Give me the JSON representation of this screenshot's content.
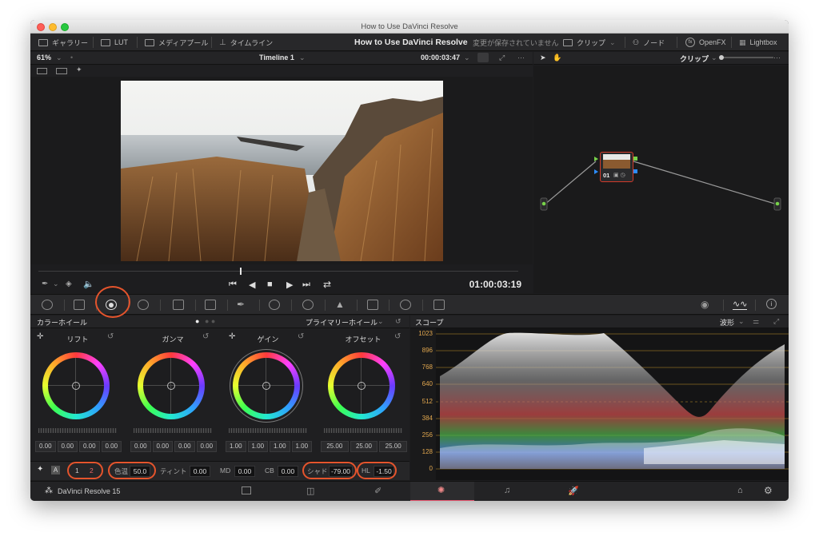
{
  "window_title": "How to Use DaVinci Resolve",
  "menubar": {
    "gallery": "ギャラリー",
    "lut": "LUT",
    "media_pool": "メディアプール",
    "timeline": "タイムライン",
    "project_title": "How to Use DaVinci Resolve",
    "unsaved": "変更が保存されていません",
    "clip": "クリップ",
    "node": "ノード",
    "openfx": "OpenFX",
    "lightbox": "Lightbox"
  },
  "viewer": {
    "zoom": "61%",
    "timeline_name": "Timeline 1",
    "timecode_top": "00:00:03:47",
    "timecode_main": "01:00:03:19"
  },
  "node_editor": {
    "mode": "クリップ",
    "node_label": "01"
  },
  "color_wheels": {
    "panel_title": "カラーホイール",
    "mode": "プライマリーホイール",
    "wheels": [
      {
        "label": "リフト",
        "values": [
          "0.00",
          "0.00",
          "0.00",
          "0.00"
        ]
      },
      {
        "label": "ガンマ",
        "values": [
          "0.00",
          "0.00",
          "0.00",
          "0.00"
        ]
      },
      {
        "label": "ゲイン",
        "values": [
          "1.00",
          "1.00",
          "1.00",
          "1.00"
        ]
      },
      {
        "label": "オフセット",
        "values": [
          "25.00",
          "25.00",
          "25.00"
        ]
      }
    ],
    "footer": {
      "page1": "1",
      "page2": "2",
      "saturation_label": "色温",
      "saturation_value": "50.0",
      "tint_label": "ティント",
      "tint_value": "0.00",
      "md_label": "MD",
      "md_value": "0.00",
      "cb_label": "CB",
      "cb_value": "0.00",
      "shadow_label": "シャド",
      "shadow_value": "-79.00",
      "hl_label": "HL",
      "hl_value": "-1.50"
    }
  },
  "scope": {
    "title": "スコープ",
    "mode": "波形",
    "axis": [
      "1023",
      "896",
      "768",
      "640",
      "512",
      "384",
      "256",
      "128",
      "0"
    ]
  },
  "bottom": {
    "app_name": "DaVinci Resolve 15"
  },
  "colors": {
    "highlight_ring": "#e5542c",
    "scope_axis": "#e0a64e",
    "node_border": "#d23a2a"
  }
}
